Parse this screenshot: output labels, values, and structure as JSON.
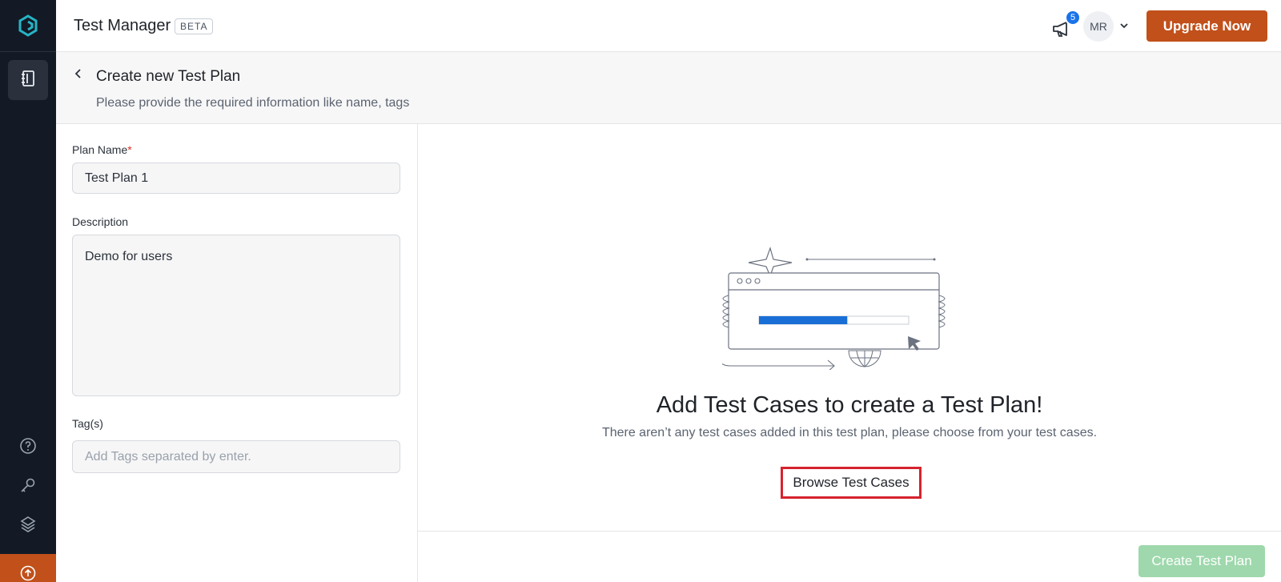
{
  "sidebar": {
    "logo_icon": "app-logo-icon",
    "nav_items": [
      {
        "icon": "notebook-icon",
        "active": true
      }
    ],
    "bottom_icons": [
      "help-circle-icon",
      "key-icon",
      "integrations-icon"
    ],
    "upgrade_icon": "arrow-up-circle-icon"
  },
  "topbar": {
    "app_title": "Test Manager",
    "beta_label": "BETA",
    "announcement_icon": "megaphone-icon",
    "notification_count": "5",
    "avatar_initials": "MR",
    "upgrade_label": "Upgrade Now"
  },
  "header": {
    "title": "Create new Test Plan",
    "subtitle": "Please provide the required information like name, tags"
  },
  "form": {
    "plan_name_label": "Plan Name",
    "required_mark": "*",
    "plan_name_value": "Test Plan 1",
    "description_label": "Description",
    "description_value": "Demo for users",
    "tags_label": "Tag(s)",
    "tags_placeholder": "Add Tags separated by enter."
  },
  "empty_state": {
    "title": "Add Test Cases to create a Test Plan!",
    "description": "There aren’t any test cases added in this test plan, please choose from your test cases.",
    "browse_label": "Browse Test Cases",
    "progress_fraction": 0.59
  },
  "footer": {
    "create_label": "Create Test Plan"
  },
  "colors": {
    "sidebar_bg": "#131a26",
    "accent_orange": "#c1501a",
    "progress_blue": "#1a6fd6",
    "highlight_red": "#d6232e",
    "create_disabled_green": "#9ed8ac"
  }
}
